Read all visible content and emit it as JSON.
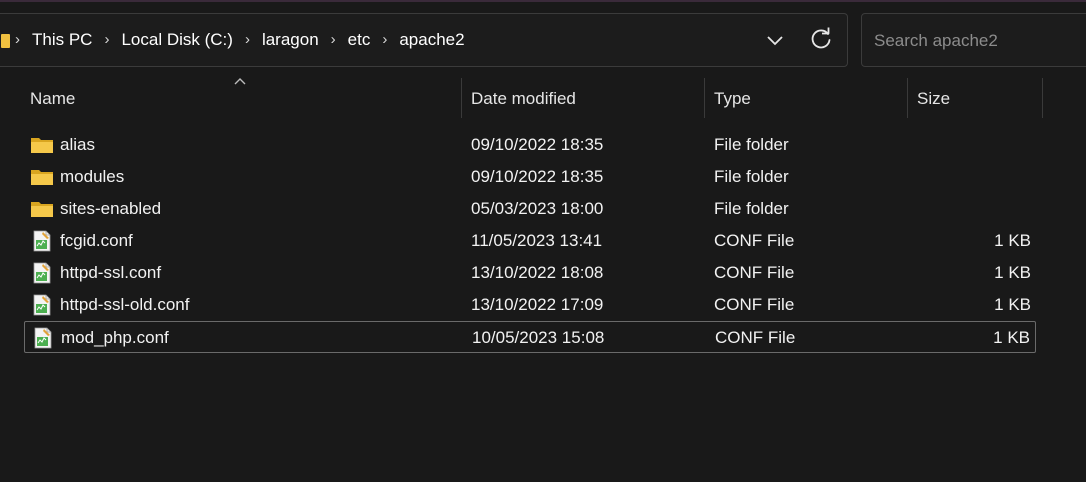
{
  "breadcrumb": [
    "This PC",
    "Local Disk (C:)",
    "laragon",
    "etc",
    "apache2"
  ],
  "search": {
    "placeholder": "Search apache2"
  },
  "columns": {
    "name": "Name",
    "date": "Date modified",
    "type": "Type",
    "size": "Size"
  },
  "files": [
    {
      "name": "alias",
      "date": "09/10/2022 18:35",
      "type": "File folder",
      "size": "",
      "icon": "folder-icon"
    },
    {
      "name": "modules",
      "date": "09/10/2022 18:35",
      "type": "File folder",
      "size": "",
      "icon": "folder-icon"
    },
    {
      "name": "sites-enabled",
      "date": "05/03/2023 18:00",
      "type": "File folder",
      "size": "",
      "icon": "folder-icon"
    },
    {
      "name": "fcgid.conf",
      "date": "11/05/2023 13:41",
      "type": "CONF File",
      "size": "1 KB",
      "icon": "conf-file-icon"
    },
    {
      "name": "httpd-ssl.conf",
      "date": "13/10/2022 18:08",
      "type": "CONF File",
      "size": "1 KB",
      "icon": "conf-file-icon"
    },
    {
      "name": "httpd-ssl-old.conf",
      "date": "13/10/2022 17:09",
      "type": "CONF File",
      "size": "1 KB",
      "icon": "conf-file-icon"
    },
    {
      "name": "mod_php.conf",
      "date": "10/05/2023 15:08",
      "type": "CONF File",
      "size": "1 KB",
      "icon": "conf-file-icon",
      "selected": true
    }
  ],
  "colors": {
    "background": "#191919",
    "folder": "#f0c040",
    "text": "#ffffff"
  }
}
